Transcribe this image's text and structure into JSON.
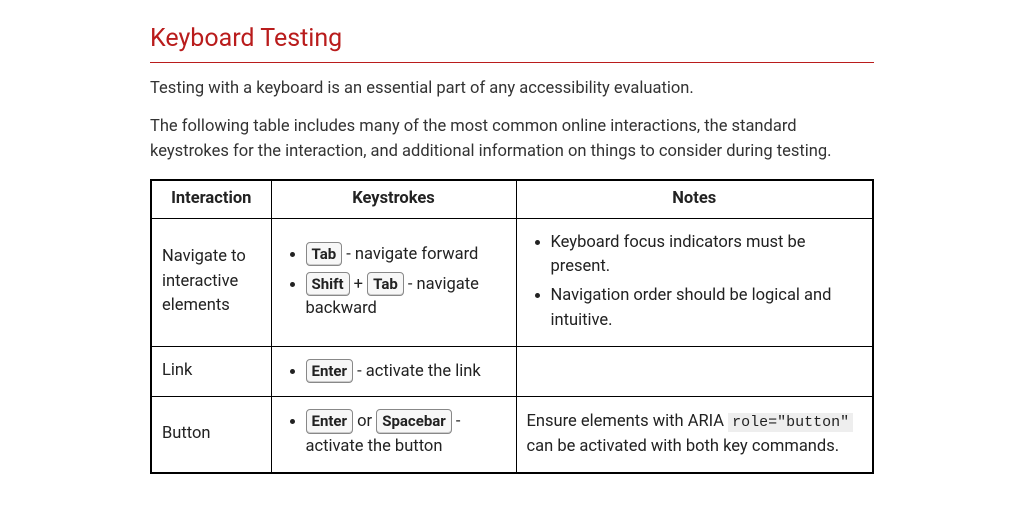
{
  "heading": "Keyboard Testing",
  "intro": {
    "p1": "Testing with a keyboard is an essential part of any accessibility evaluation.",
    "p2": "The following table includes many of the most common online interactions, the standard keystrokes for the interaction, and additional information on things to consider during testing."
  },
  "table": {
    "headers": {
      "interaction": "Interaction",
      "keystrokes": "Keystrokes",
      "notes": "Notes"
    },
    "rows": {
      "r1": {
        "interaction": "Navigate to interactive elements",
        "keystroke1": {
          "key1": "Tab",
          "rest": " - navigate forward"
        },
        "keystroke2": {
          "key1": "Shift",
          "plus": " + ",
          "key2": "Tab",
          "rest": " - navigate backward"
        },
        "note1": "Keyboard focus indicators must be present.",
        "note2": "Navigation order should be logical and intuitive."
      },
      "r2": {
        "interaction": "Link",
        "keystroke1": {
          "key1": "Enter",
          "rest": " - activate the link"
        }
      },
      "r3": {
        "interaction": "Button",
        "keystroke1": {
          "key1": "Enter",
          "or": " or ",
          "key2": "Spacebar",
          "rest": " - activate the button"
        },
        "note": {
          "pre": "Ensure elements with ARIA ",
          "code": "role=\"button\"",
          "post": " can be activated with both key commands."
        }
      }
    }
  }
}
